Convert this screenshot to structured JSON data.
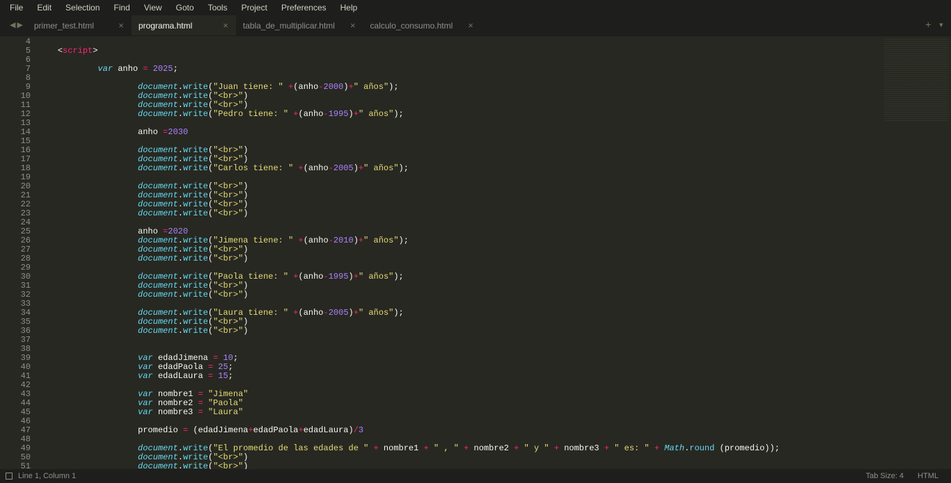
{
  "menu": {
    "items": [
      "File",
      "Edit",
      "Selection",
      "Find",
      "View",
      "Goto",
      "Tools",
      "Project",
      "Preferences",
      "Help"
    ]
  },
  "tabs": [
    {
      "label": "primer_test.html",
      "active": false
    },
    {
      "label": "programa.html",
      "active": true
    },
    {
      "label": "tabla_de_multiplicar.html",
      "active": false
    },
    {
      "label": "calculo_consumo.html",
      "active": false
    }
  ],
  "tab_actions": {
    "plus": "+",
    "down": "▾"
  },
  "nav": {
    "back": "◀",
    "fwd": "▶"
  },
  "close_glyph": "×",
  "status": {
    "pos": "Line 1, Column 1",
    "tabsize": "Tab Size: 4",
    "syntax": "HTML"
  },
  "gutter": {
    "start": 4,
    "end": 51,
    "folds": [
      5,
      7
    ]
  },
  "code_lines": [
    {
      "n": 4,
      "i": 0,
      "t": []
    },
    {
      "n": 5,
      "i": 0,
      "t": [
        [
          "ang",
          "<"
        ],
        [
          "tag",
          "script"
        ],
        [
          "ang",
          ">"
        ]
      ]
    },
    {
      "n": 6,
      "i": 0,
      "t": []
    },
    {
      "n": 7,
      "i": 2,
      "t": [
        [
          "storage",
          "var"
        ],
        [
          "white",
          " anho "
        ],
        [
          "op",
          "="
        ],
        [
          "white",
          " "
        ],
        [
          "num",
          "2025"
        ],
        [
          "punct",
          ";"
        ]
      ]
    },
    {
      "n": 8,
      "i": 0,
      "t": []
    },
    {
      "n": 9,
      "i": 4,
      "t": [
        [
          "obj",
          "document"
        ],
        [
          "punct",
          "."
        ],
        [
          "func",
          "write"
        ],
        [
          "punct",
          "("
        ],
        [
          "str",
          "\"Juan tiene: \""
        ],
        [
          "white",
          " "
        ],
        [
          "op",
          "+"
        ],
        [
          "punct",
          "("
        ],
        [
          "white",
          "anho"
        ],
        [
          "op",
          "-"
        ],
        [
          "num",
          "2000"
        ],
        [
          "punct",
          ")"
        ],
        [
          "op",
          "+"
        ],
        [
          "str",
          "\" años\""
        ],
        [
          "punct",
          ");"
        ]
      ]
    },
    {
      "n": 10,
      "i": 4,
      "t": [
        [
          "obj",
          "document"
        ],
        [
          "punct",
          "."
        ],
        [
          "func",
          "write"
        ],
        [
          "punct",
          "("
        ],
        [
          "str",
          "\"<br>\""
        ],
        [
          "punct",
          ")"
        ]
      ]
    },
    {
      "n": 11,
      "i": 4,
      "t": [
        [
          "obj",
          "document"
        ],
        [
          "punct",
          "."
        ],
        [
          "func",
          "write"
        ],
        [
          "punct",
          "("
        ],
        [
          "str",
          "\"<br>\""
        ],
        [
          "punct",
          ")"
        ]
      ]
    },
    {
      "n": 12,
      "i": 4,
      "t": [
        [
          "obj",
          "document"
        ],
        [
          "punct",
          "."
        ],
        [
          "func",
          "write"
        ],
        [
          "punct",
          "("
        ],
        [
          "str",
          "\"Pedro tiene: \""
        ],
        [
          "white",
          " "
        ],
        [
          "op",
          "+"
        ],
        [
          "punct",
          "("
        ],
        [
          "white",
          "anho"
        ],
        [
          "op",
          "-"
        ],
        [
          "num",
          "1995"
        ],
        [
          "punct",
          ")"
        ],
        [
          "op",
          "+"
        ],
        [
          "str",
          "\" años\""
        ],
        [
          "punct",
          ");"
        ]
      ]
    },
    {
      "n": 13,
      "i": 0,
      "t": []
    },
    {
      "n": 14,
      "i": 4,
      "t": [
        [
          "white",
          "anho "
        ],
        [
          "op",
          "="
        ],
        [
          "num",
          "2030"
        ]
      ]
    },
    {
      "n": 15,
      "i": 0,
      "t": []
    },
    {
      "n": 16,
      "i": 4,
      "t": [
        [
          "obj",
          "document"
        ],
        [
          "punct",
          "."
        ],
        [
          "func",
          "write"
        ],
        [
          "punct",
          "("
        ],
        [
          "str",
          "\"<br>\""
        ],
        [
          "punct",
          ")"
        ]
      ]
    },
    {
      "n": 17,
      "i": 4,
      "t": [
        [
          "obj",
          "document"
        ],
        [
          "punct",
          "."
        ],
        [
          "func",
          "write"
        ],
        [
          "punct",
          "("
        ],
        [
          "str",
          "\"<br>\""
        ],
        [
          "punct",
          ")"
        ]
      ]
    },
    {
      "n": 18,
      "i": 4,
      "t": [
        [
          "obj",
          "document"
        ],
        [
          "punct",
          "."
        ],
        [
          "func",
          "write"
        ],
        [
          "punct",
          "("
        ],
        [
          "str",
          "\"Carlos tiene: \""
        ],
        [
          "white",
          " "
        ],
        [
          "op",
          "+"
        ],
        [
          "punct",
          "("
        ],
        [
          "white",
          "anho"
        ],
        [
          "op",
          "-"
        ],
        [
          "num",
          "2005"
        ],
        [
          "punct",
          ")"
        ],
        [
          "op",
          "+"
        ],
        [
          "str",
          "\" años\""
        ],
        [
          "punct",
          ");"
        ]
      ]
    },
    {
      "n": 19,
      "i": 0,
      "t": []
    },
    {
      "n": 20,
      "i": 4,
      "t": [
        [
          "obj",
          "document"
        ],
        [
          "punct",
          "."
        ],
        [
          "func",
          "write"
        ],
        [
          "punct",
          "("
        ],
        [
          "str",
          "\"<br>\""
        ],
        [
          "punct",
          ")"
        ]
      ]
    },
    {
      "n": 21,
      "i": 4,
      "t": [
        [
          "obj",
          "document"
        ],
        [
          "punct",
          "."
        ],
        [
          "func",
          "write"
        ],
        [
          "punct",
          "("
        ],
        [
          "str",
          "\"<br>\""
        ],
        [
          "punct",
          ")"
        ]
      ]
    },
    {
      "n": 22,
      "i": 4,
      "t": [
        [
          "obj",
          "document"
        ],
        [
          "punct",
          "."
        ],
        [
          "func",
          "write"
        ],
        [
          "punct",
          "("
        ],
        [
          "str",
          "\"<br>\""
        ],
        [
          "punct",
          ")"
        ]
      ]
    },
    {
      "n": 23,
      "i": 4,
      "t": [
        [
          "obj",
          "document"
        ],
        [
          "punct",
          "."
        ],
        [
          "func",
          "write"
        ],
        [
          "punct",
          "("
        ],
        [
          "str",
          "\"<br>\""
        ],
        [
          "punct",
          ")"
        ]
      ]
    },
    {
      "n": 24,
      "i": 0,
      "t": []
    },
    {
      "n": 25,
      "i": 4,
      "t": [
        [
          "white",
          "anho "
        ],
        [
          "op",
          "="
        ],
        [
          "num",
          "2020"
        ]
      ]
    },
    {
      "n": 26,
      "i": 4,
      "t": [
        [
          "obj",
          "document"
        ],
        [
          "punct",
          "."
        ],
        [
          "func",
          "write"
        ],
        [
          "punct",
          "("
        ],
        [
          "str",
          "\"Jimena tiene: \""
        ],
        [
          "white",
          " "
        ],
        [
          "op",
          "+"
        ],
        [
          "punct",
          "("
        ],
        [
          "white",
          "anho"
        ],
        [
          "op",
          "-"
        ],
        [
          "num",
          "2010"
        ],
        [
          "punct",
          ")"
        ],
        [
          "op",
          "+"
        ],
        [
          "str",
          "\" años\""
        ],
        [
          "punct",
          ");"
        ]
      ]
    },
    {
      "n": 27,
      "i": 4,
      "t": [
        [
          "obj",
          "document"
        ],
        [
          "punct",
          "."
        ],
        [
          "func",
          "write"
        ],
        [
          "punct",
          "("
        ],
        [
          "str",
          "\"<br>\""
        ],
        [
          "punct",
          ")"
        ]
      ]
    },
    {
      "n": 28,
      "i": 4,
      "t": [
        [
          "obj",
          "document"
        ],
        [
          "punct",
          "."
        ],
        [
          "func",
          "write"
        ],
        [
          "punct",
          "("
        ],
        [
          "str",
          "\"<br>\""
        ],
        [
          "punct",
          ")"
        ]
      ]
    },
    {
      "n": 29,
      "i": 0,
      "t": []
    },
    {
      "n": 30,
      "i": 4,
      "t": [
        [
          "obj",
          "document"
        ],
        [
          "punct",
          "."
        ],
        [
          "func",
          "write"
        ],
        [
          "punct",
          "("
        ],
        [
          "str",
          "\"Paola tiene: \""
        ],
        [
          "white",
          " "
        ],
        [
          "op",
          "+"
        ],
        [
          "punct",
          "("
        ],
        [
          "white",
          "anho"
        ],
        [
          "op",
          "-"
        ],
        [
          "num",
          "1995"
        ],
        [
          "punct",
          ")"
        ],
        [
          "op",
          "+"
        ],
        [
          "str",
          "\" años\""
        ],
        [
          "punct",
          ");"
        ]
      ]
    },
    {
      "n": 31,
      "i": 4,
      "t": [
        [
          "obj",
          "document"
        ],
        [
          "punct",
          "."
        ],
        [
          "func",
          "write"
        ],
        [
          "punct",
          "("
        ],
        [
          "str",
          "\"<br>\""
        ],
        [
          "punct",
          ")"
        ]
      ]
    },
    {
      "n": 32,
      "i": 4,
      "t": [
        [
          "obj",
          "document"
        ],
        [
          "punct",
          "."
        ],
        [
          "func",
          "write"
        ],
        [
          "punct",
          "("
        ],
        [
          "str",
          "\"<br>\""
        ],
        [
          "punct",
          ")"
        ]
      ]
    },
    {
      "n": 33,
      "i": 0,
      "t": []
    },
    {
      "n": 34,
      "i": 4,
      "t": [
        [
          "obj",
          "document"
        ],
        [
          "punct",
          "."
        ],
        [
          "func",
          "write"
        ],
        [
          "punct",
          "("
        ],
        [
          "str",
          "\"Laura tiene: \""
        ],
        [
          "white",
          " "
        ],
        [
          "op",
          "+"
        ],
        [
          "punct",
          "("
        ],
        [
          "white",
          "anho"
        ],
        [
          "op",
          "-"
        ],
        [
          "num",
          "2005"
        ],
        [
          "punct",
          ")"
        ],
        [
          "op",
          "+"
        ],
        [
          "str",
          "\" años\""
        ],
        [
          "punct",
          ");"
        ]
      ]
    },
    {
      "n": 35,
      "i": 4,
      "t": [
        [
          "obj",
          "document"
        ],
        [
          "punct",
          "."
        ],
        [
          "func",
          "write"
        ],
        [
          "punct",
          "("
        ],
        [
          "str",
          "\"<br>\""
        ],
        [
          "punct",
          ")"
        ]
      ]
    },
    {
      "n": 36,
      "i": 4,
      "t": [
        [
          "obj",
          "document"
        ],
        [
          "punct",
          "."
        ],
        [
          "func",
          "write"
        ],
        [
          "punct",
          "("
        ],
        [
          "str",
          "\"<br>\""
        ],
        [
          "punct",
          ")"
        ]
      ]
    },
    {
      "n": 37,
      "i": 0,
      "t": []
    },
    {
      "n": 38,
      "i": 0,
      "t": []
    },
    {
      "n": 39,
      "i": 4,
      "t": [
        [
          "storage",
          "var"
        ],
        [
          "white",
          " edadJimena "
        ],
        [
          "op",
          "="
        ],
        [
          "white",
          " "
        ],
        [
          "num",
          "10"
        ],
        [
          "punct",
          ";"
        ]
      ]
    },
    {
      "n": 40,
      "i": 4,
      "t": [
        [
          "storage",
          "var"
        ],
        [
          "white",
          " edadPaola "
        ],
        [
          "op",
          "="
        ],
        [
          "white",
          " "
        ],
        [
          "num",
          "25"
        ],
        [
          "punct",
          ";"
        ]
      ]
    },
    {
      "n": 41,
      "i": 4,
      "t": [
        [
          "storage",
          "var"
        ],
        [
          "white",
          " edadLaura "
        ],
        [
          "op",
          "="
        ],
        [
          "white",
          " "
        ],
        [
          "num",
          "15"
        ],
        [
          "punct",
          ";"
        ]
      ]
    },
    {
      "n": 42,
      "i": 0,
      "t": []
    },
    {
      "n": 43,
      "i": 4,
      "t": [
        [
          "storage",
          "var"
        ],
        [
          "white",
          " nombre1 "
        ],
        [
          "op",
          "="
        ],
        [
          "white",
          " "
        ],
        [
          "str",
          "\"Jimena\""
        ]
      ]
    },
    {
      "n": 44,
      "i": 4,
      "t": [
        [
          "storage",
          "var"
        ],
        [
          "white",
          " nombre2 "
        ],
        [
          "op",
          "="
        ],
        [
          "white",
          " "
        ],
        [
          "str",
          "\"Paola\""
        ]
      ]
    },
    {
      "n": 45,
      "i": 4,
      "t": [
        [
          "storage",
          "var"
        ],
        [
          "white",
          " nombre3 "
        ],
        [
          "op",
          "="
        ],
        [
          "white",
          " "
        ],
        [
          "str",
          "\"Laura\""
        ]
      ]
    },
    {
      "n": 46,
      "i": 0,
      "t": []
    },
    {
      "n": 47,
      "i": 4,
      "t": [
        [
          "white",
          "promedio "
        ],
        [
          "op",
          "="
        ],
        [
          "white",
          " "
        ],
        [
          "punct",
          "("
        ],
        [
          "white",
          "edadJimena"
        ],
        [
          "op",
          "+"
        ],
        [
          "white",
          "edadPaola"
        ],
        [
          "op",
          "+"
        ],
        [
          "white",
          "edadLaura"
        ],
        [
          "punct",
          ")"
        ],
        [
          "op",
          "/"
        ],
        [
          "num",
          "3"
        ]
      ]
    },
    {
      "n": 48,
      "i": 0,
      "t": []
    },
    {
      "n": 49,
      "i": 4,
      "t": [
        [
          "obj",
          "document"
        ],
        [
          "punct",
          "."
        ],
        [
          "func",
          "write"
        ],
        [
          "punct",
          "("
        ],
        [
          "str",
          "\"El promedio de las edades de \""
        ],
        [
          "white",
          " "
        ],
        [
          "op",
          "+"
        ],
        [
          "white",
          " nombre1 "
        ],
        [
          "op",
          "+"
        ],
        [
          "white",
          " "
        ],
        [
          "str",
          "\" , \""
        ],
        [
          "white",
          " "
        ],
        [
          "op",
          "+"
        ],
        [
          "white",
          " nombre2 "
        ],
        [
          "op",
          "+"
        ],
        [
          "white",
          " "
        ],
        [
          "str",
          "\" y \""
        ],
        [
          "white",
          " "
        ],
        [
          "op",
          "+"
        ],
        [
          "white",
          " nombre3 "
        ],
        [
          "op",
          "+"
        ],
        [
          "white",
          " "
        ],
        [
          "str",
          "\" es: \""
        ],
        [
          "white",
          " "
        ],
        [
          "op",
          "+"
        ],
        [
          "white",
          " "
        ],
        [
          "builtin",
          "Math"
        ],
        [
          "punct",
          "."
        ],
        [
          "func",
          "round"
        ],
        [
          "white",
          " "
        ],
        [
          "punct",
          "("
        ],
        [
          "white",
          "promedio"
        ],
        [
          "punct",
          "));"
        ]
      ]
    },
    {
      "n": 50,
      "i": 4,
      "t": [
        [
          "obj",
          "document"
        ],
        [
          "punct",
          "."
        ],
        [
          "func",
          "write"
        ],
        [
          "punct",
          "("
        ],
        [
          "str",
          "\"<br>\""
        ],
        [
          "punct",
          ")"
        ]
      ]
    },
    {
      "n": 51,
      "i": 4,
      "t": [
        [
          "obj",
          "document"
        ],
        [
          "punct",
          "."
        ],
        [
          "func",
          "write"
        ],
        [
          "punct",
          "("
        ],
        [
          "str",
          "\"<br>\""
        ],
        [
          "punct",
          ")"
        ]
      ]
    }
  ]
}
